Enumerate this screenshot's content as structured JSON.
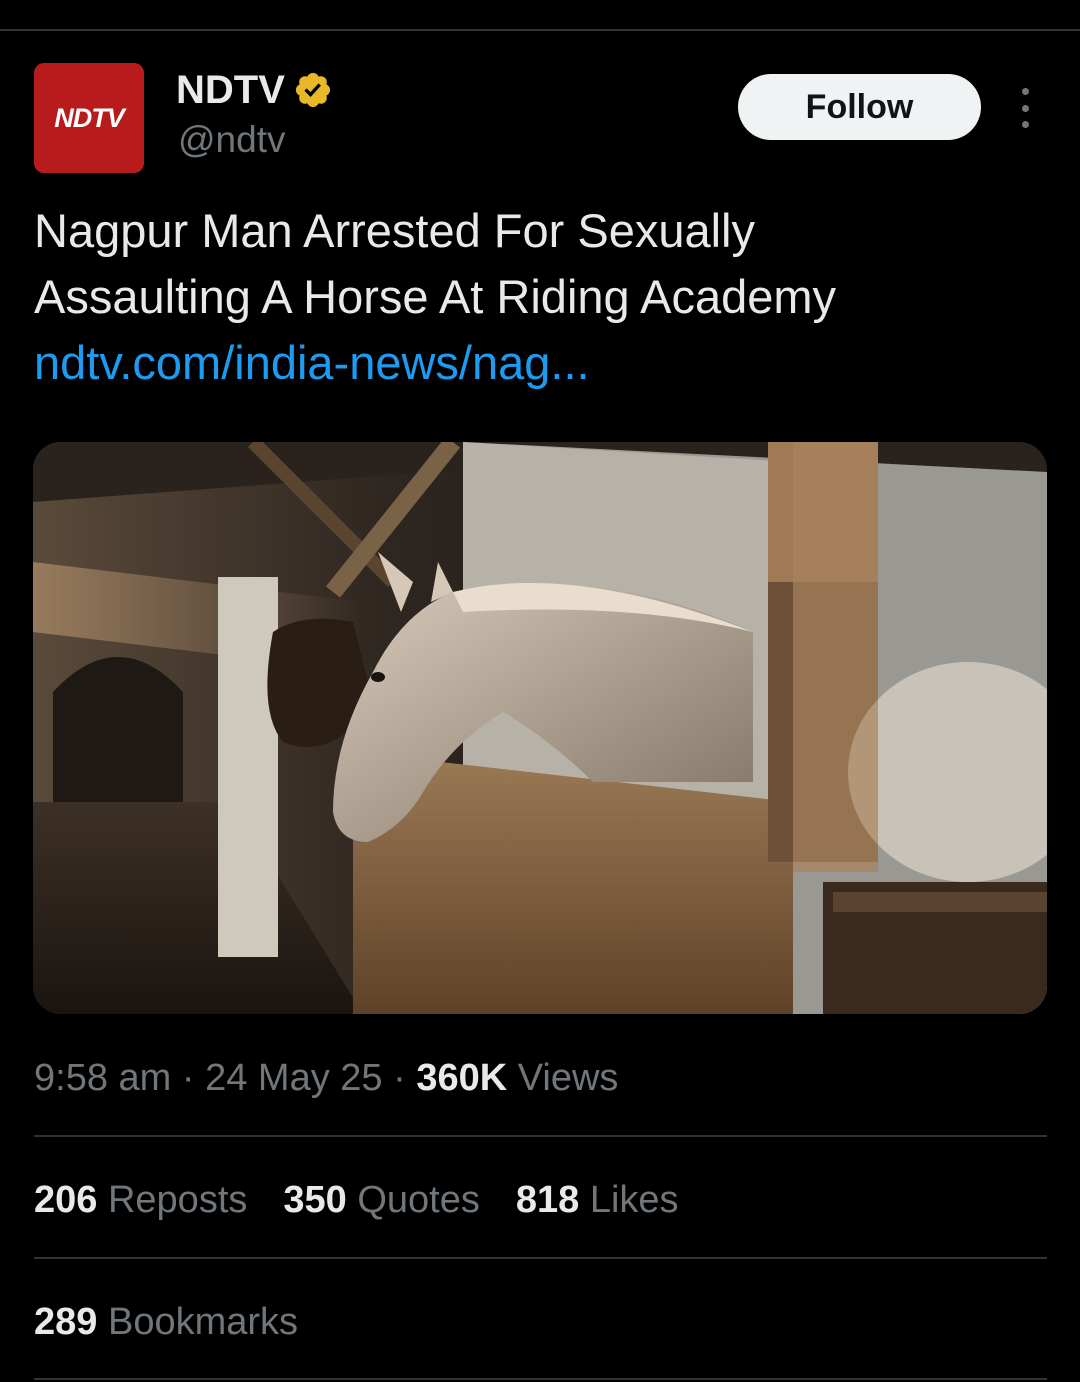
{
  "author": {
    "avatar_text": "NDTV",
    "display_name": "NDTV",
    "handle": "@ndtv",
    "verified": true,
    "avatar_color": "#b81b1b",
    "verified_color": "#e8b829"
  },
  "header": {
    "follow_label": "Follow",
    "more_icon": "more-vertical-icon"
  },
  "tweet": {
    "text_line_1": "Nagpur Man Arrested For Sexually",
    "text_line_2": "Assaulting A Horse At Riding Academy",
    "link_text": "ndtv.com/india-news/nag...",
    "link_color": "#1d9bf0"
  },
  "meta": {
    "time": "9:58 am",
    "separator": "·",
    "date": "24 May 25",
    "views_count": "360K",
    "views_label": "Views"
  },
  "stats": {
    "reposts_count": "206",
    "reposts_label": "Reposts",
    "quotes_count": "350",
    "quotes_label": "Quotes",
    "likes_count": "818",
    "likes_label": "Likes",
    "bookmarks_count": "289",
    "bookmarks_label": "Bookmarks"
  }
}
